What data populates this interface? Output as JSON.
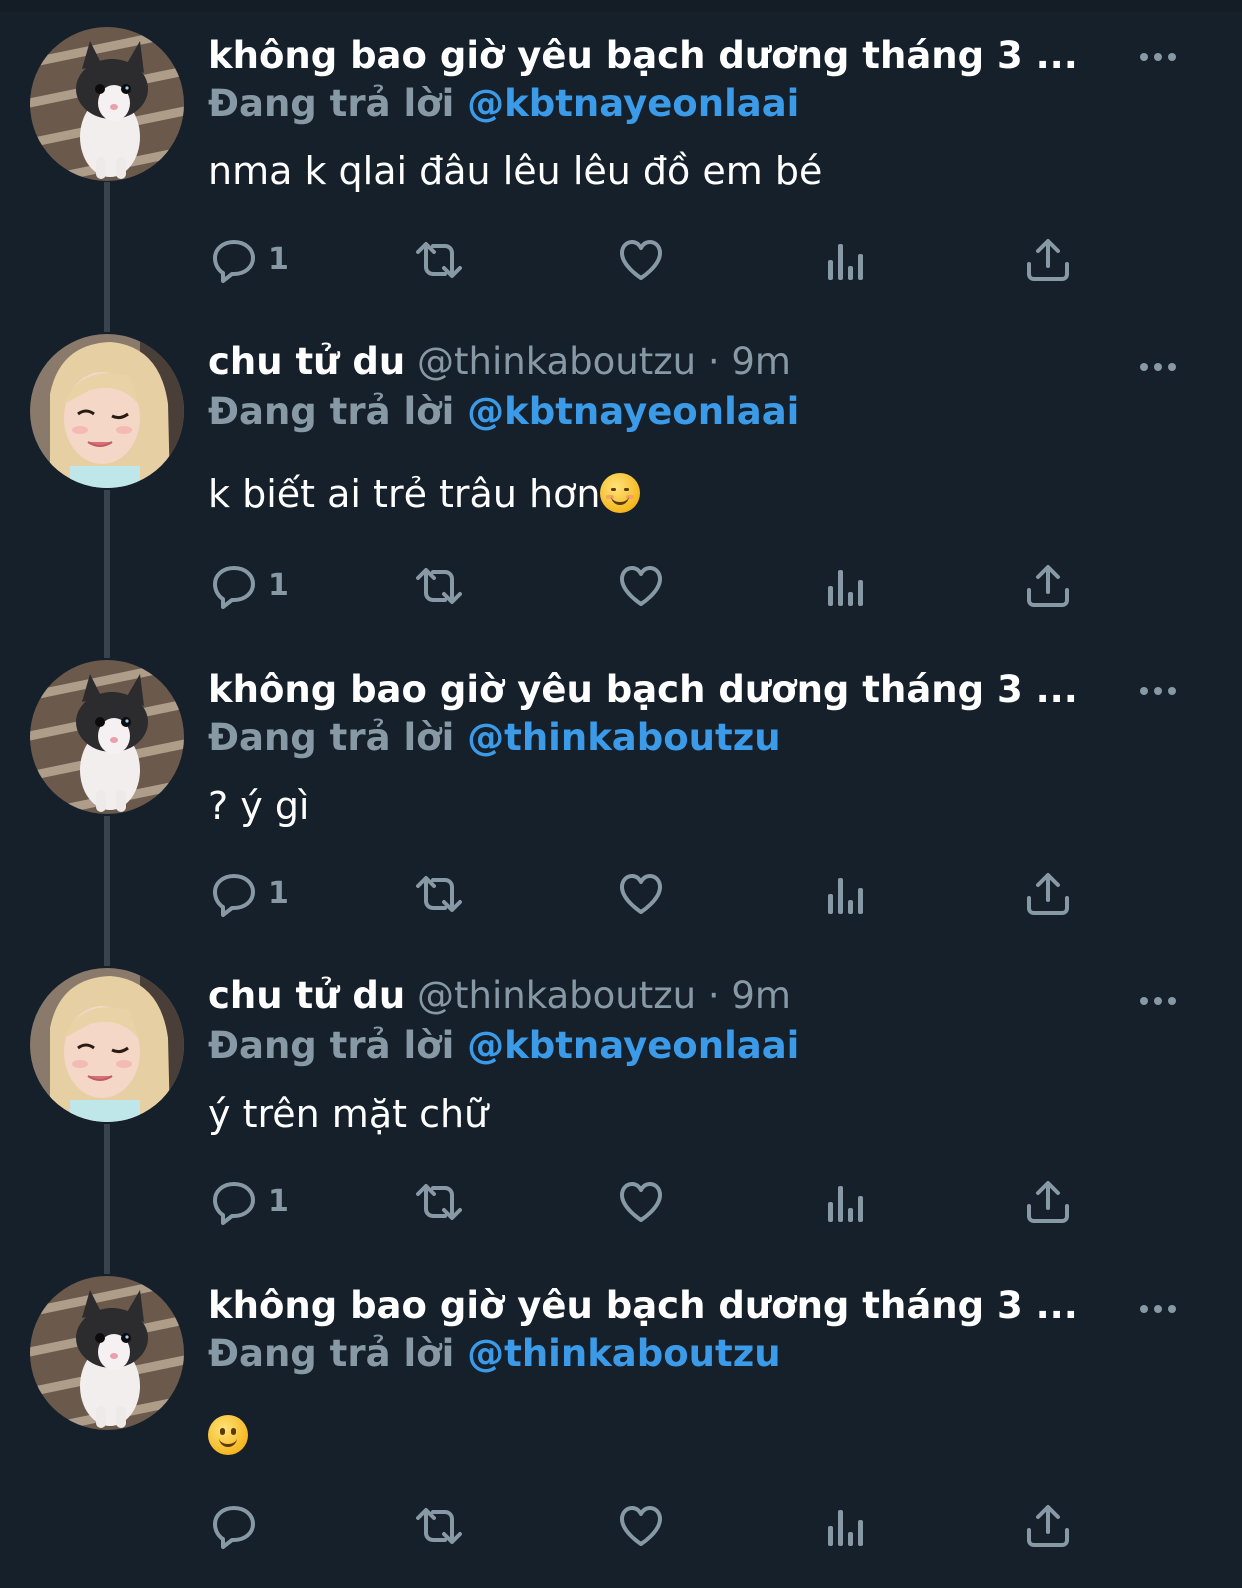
{
  "tweets": [
    {
      "name": "không bao giờ yêu bạch dương tháng 3 ...",
      "handle_time": "",
      "replying_label": "Đang trả lời",
      "mention": "@kbtnayeonlaai",
      "text": "nma k qlai đâu lêu lêu đồ em bé",
      "reply_count": "1",
      "avatar_icon": "cat-avatar"
    },
    {
      "name": "chu tử du",
      "handle_time": "@thinkaboutzu · 9m",
      "replying_label": "Đang trả lời",
      "mention": "@kbtnayeonlaai",
      "text": "k biết ai trẻ trâu hơn",
      "emoji": "smiling-face-emoji",
      "reply_count": "1",
      "avatar_icon": "girl-avatar"
    },
    {
      "name": "không bao giờ yêu bạch dương tháng 3 ...",
      "handle_time": "",
      "replying_label": "Đang trả lời",
      "mention": "@thinkaboutzu",
      "text": "? ý gì",
      "reply_count": "1",
      "avatar_icon": "cat-avatar"
    },
    {
      "name": "chu tử du",
      "handle_time": "@thinkaboutzu · 9m",
      "replying_label": "Đang trả lời",
      "mention": "@kbtnayeonlaai",
      "text": "ý trên mặt chữ",
      "reply_count": "1",
      "avatar_icon": "girl-avatar"
    },
    {
      "name": "không bao giờ yêu bạch dương tháng 3 ...",
      "handle_time": "",
      "replying_label": "Đang trả lời",
      "mention": "@thinkaboutzu",
      "text": "",
      "emoji": "slightly-smiling-face-emoji",
      "reply_count": "",
      "avatar_icon": "cat-avatar"
    }
  ],
  "colors": {
    "background": "#15202b",
    "secondary_text": "#8899a6",
    "mention": "#3b9be8",
    "thread_line": "#38444d"
  },
  "icons": [
    "reply-icon",
    "retweet-icon",
    "like-icon",
    "analytics-icon",
    "share-icon",
    "more-icon"
  ]
}
